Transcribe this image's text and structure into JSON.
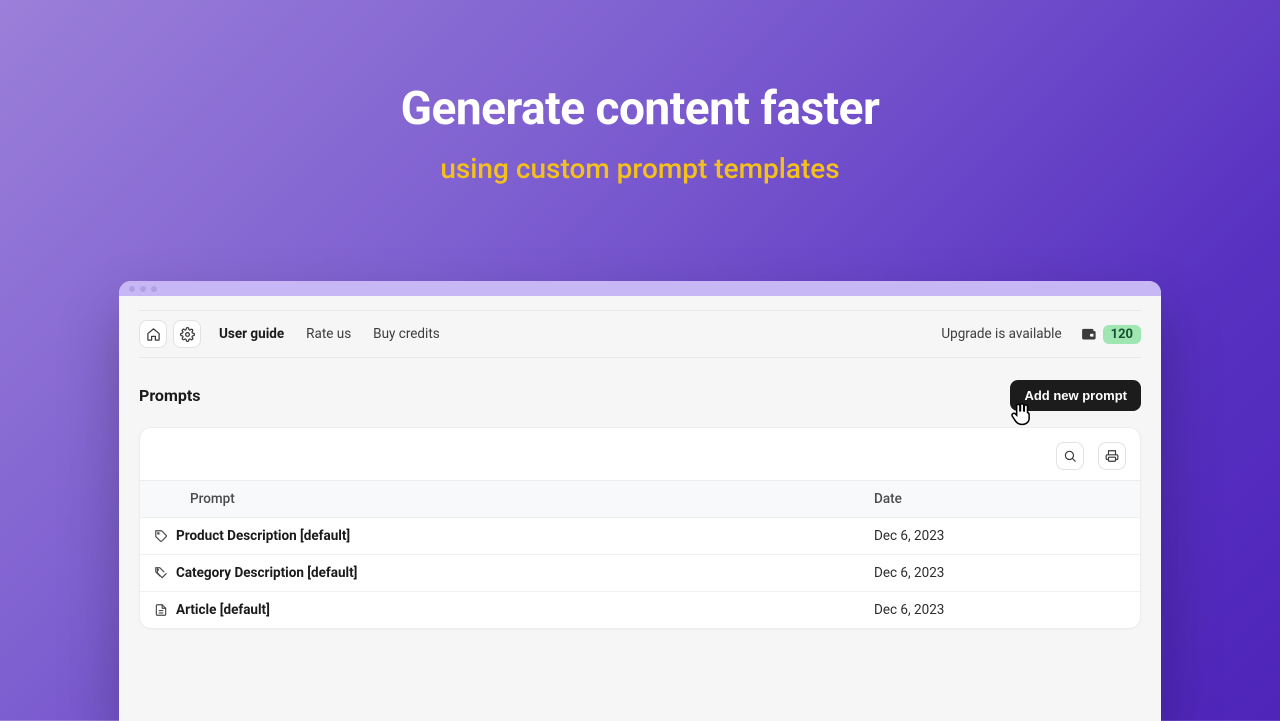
{
  "hero": {
    "title": "Generate content faster",
    "subtitle": "using custom prompt templates"
  },
  "topbar": {
    "links": {
      "user_guide": "User guide",
      "rate_us": "Rate us",
      "buy_credits": "Buy credits"
    },
    "upgrade": "Upgrade is available",
    "credits": "120"
  },
  "page": {
    "title": "Prompts",
    "add_button": "Add new prompt"
  },
  "table": {
    "headers": {
      "prompt": "Prompt",
      "date": "Date"
    },
    "rows": [
      {
        "name": "Product Description [default]",
        "date": "Dec 6, 2023",
        "icon": "tag"
      },
      {
        "name": "Category Description [default]",
        "date": "Dec 6, 2023",
        "icon": "tags"
      },
      {
        "name": "Article [default]",
        "date": "Dec 6, 2023",
        "icon": "doc"
      }
    ]
  }
}
